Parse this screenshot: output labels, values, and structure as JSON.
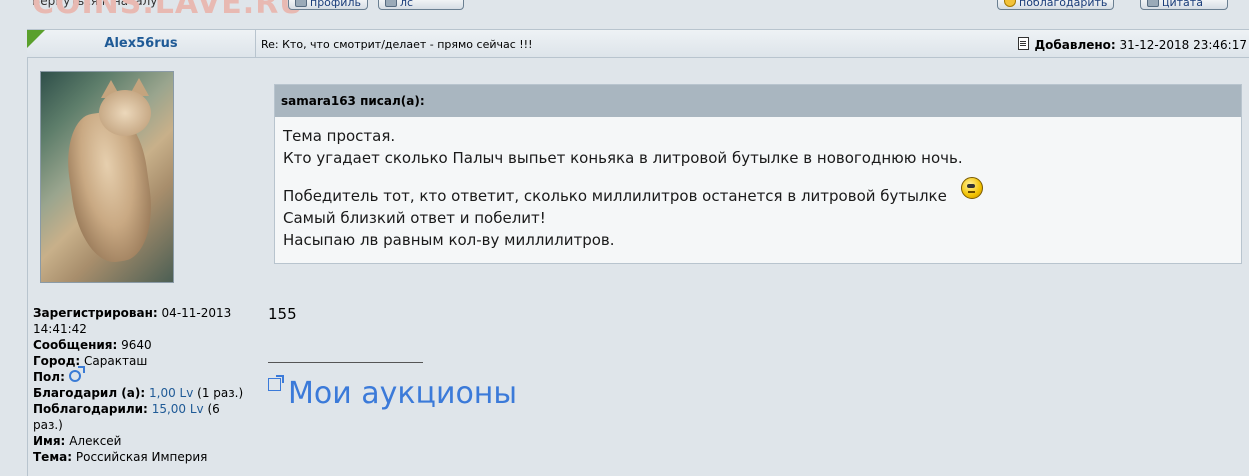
{
  "topnav": {
    "back_link": "Вернуться к началу",
    "profile_button": "профиль",
    "pm_button": "лс",
    "thank_button": "поблагодарить",
    "quote_button": "цитата",
    "watermark": "COINS.LAVE.RU"
  },
  "post": {
    "author": "Alex56rus",
    "subject": "Re: Кто, что смотрит/делает - прямо сейчас !!!",
    "date_label": "Добавлено:",
    "date_value": "31-12-2018 23:46:17"
  },
  "user": {
    "registered_label": "Зарегистрирован:",
    "registered_value": "04-11-2013 14:41:42",
    "messages_label": "Сообщения:",
    "messages_value": "9640",
    "city_label": "Город:",
    "city_value": "Саракташ",
    "gender_label": "Пол:",
    "thanked_label": "Благодарил (а):",
    "thanked_value": "1,00 Lv",
    "thanked_times": "(1 раз.)",
    "thanks_label": "Поблагодарили:",
    "thanks_value": "15,00 Lv",
    "thanks_times": "(6 раз.)",
    "name_label": "Имя:",
    "name_value": "Алексей",
    "topic_label": "Тема:",
    "topic_value": "Российская Империя"
  },
  "quote": {
    "header": "samara163 писал(а):",
    "line1": "Тема простая.",
    "line2": "Кто угадает сколько Палыч выпьет коньяка в литровой бутылке в новогоднюю ночь.",
    "line3": "Победитель тот, кто ответит, сколько миллилитров останется в литровой бутылке",
    "line4": "Самый близкий ответ и побелит!",
    "line5": "Насыпаю лв равным кол-ву миллилитров."
  },
  "reply": {
    "answer": "155",
    "signature_link": "Мои аукционы"
  },
  "colors": {
    "accent": "#1f5a96",
    "link": "#3b7ad9",
    "quote_header": "#a9b6c0",
    "background": "#dfe5ea"
  }
}
